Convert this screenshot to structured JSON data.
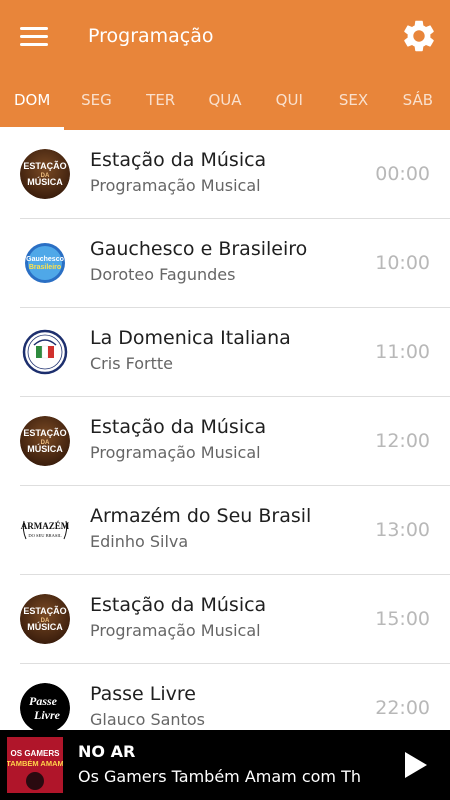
{
  "header": {
    "title": "Programação",
    "menu_icon": "menu-icon",
    "settings_icon": "gear-icon"
  },
  "colors": {
    "accent": "#E8853A",
    "player_background": "#000000"
  },
  "tabs": [
    {
      "label": "DOM",
      "active": true
    },
    {
      "label": "SEG",
      "active": false
    },
    {
      "label": "TER",
      "active": false
    },
    {
      "label": "QUA",
      "active": false
    },
    {
      "label": "QUI",
      "active": false
    },
    {
      "label": "SEX",
      "active": false
    },
    {
      "label": "SÁB",
      "active": false
    }
  ],
  "schedule": [
    {
      "title": "Estação da Música",
      "host": "Programação Musical",
      "time": "00:00",
      "logo": "estacao-da-musica-logo",
      "logo_lines": [
        "ESTAÇÃO",
        "DA",
        "MÚSICA"
      ]
    },
    {
      "title": "Gauchesco e Brasileiro",
      "host": "Doroteo Fagundes",
      "time": "10:00",
      "logo": "gauchesco-e-brasileiro-logo",
      "logo_lines": [
        "Gauchesco",
        "Brasileiro"
      ]
    },
    {
      "title": "La Domenica Italiana",
      "host": "Cris Fortte",
      "time": "11:00",
      "logo": "la-domenica-italiana-logo",
      "logo_lines": []
    },
    {
      "title": "Estação da Música",
      "host": "Programação Musical",
      "time": "12:00",
      "logo": "estacao-da-musica-logo",
      "logo_lines": [
        "ESTAÇÃO",
        "DA",
        "MÚSICA"
      ]
    },
    {
      "title": "Armazém do Seu Brasil",
      "host": "Edinho Silva",
      "time": "13:00",
      "logo": "armazem-do-seu-brasil-logo",
      "logo_lines": [
        "ARMAZÉM",
        "DO SEU BRASIL"
      ]
    },
    {
      "title": "Estação da Música",
      "host": "Programação Musical",
      "time": "15:00",
      "logo": "estacao-da-musica-logo",
      "logo_lines": [
        "ESTAÇÃO",
        "DA",
        "MÚSICA"
      ]
    },
    {
      "title": "Passe Livre",
      "host": "Glauco Santos",
      "time": "22:00",
      "logo": "passe-livre-logo",
      "logo_lines": [
        "Passe",
        "Livre"
      ]
    }
  ],
  "player": {
    "live_label": "NO AR",
    "now_playing": "Os Gamers Também Amam com Th",
    "cover_lines": [
      "OS GAMERS",
      "TAMBÉM AMAM"
    ],
    "play_icon": "play-icon"
  }
}
